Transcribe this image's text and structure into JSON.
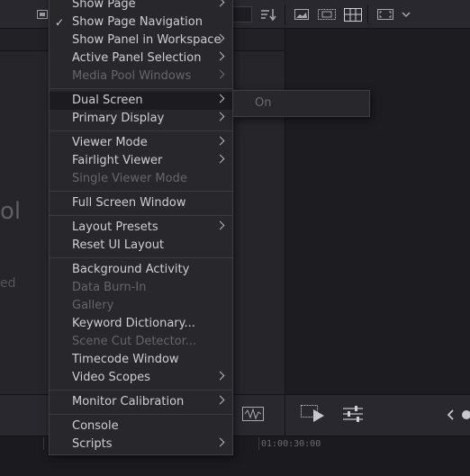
{
  "menu": {
    "items": [
      {
        "label": "Show Page",
        "submenu": true
      },
      {
        "label": "Show Page Navigation",
        "checked": true
      },
      {
        "label": "Show Panel in Workspace",
        "submenu": true
      },
      {
        "label": "Active Panel Selection",
        "submenu": true
      },
      {
        "label": "Media Pool Windows",
        "submenu": true,
        "disabled": true
      },
      {
        "label": "Dual Screen",
        "submenu": true,
        "highlighted": true
      },
      {
        "label": "Primary Display",
        "submenu": true
      },
      {
        "label": "Viewer Mode",
        "submenu": true
      },
      {
        "label": "Fairlight Viewer",
        "submenu": true
      },
      {
        "label": "Single Viewer Mode",
        "disabled": true
      },
      {
        "label": "Full Screen Window"
      },
      {
        "label": "Layout Presets",
        "submenu": true
      },
      {
        "label": "Reset UI Layout"
      },
      {
        "label": "Background Activity"
      },
      {
        "label": "Data Burn-In",
        "disabled": true
      },
      {
        "label": "Gallery",
        "disabled": true
      },
      {
        "label": "Keyword Dictionary..."
      },
      {
        "label": "Scene Cut Detector...",
        "disabled": true
      },
      {
        "label": "Timecode Window"
      },
      {
        "label": "Video Scopes",
        "submenu": true
      },
      {
        "label": "Monitor Calibration",
        "submenu": true
      },
      {
        "label": "Console"
      },
      {
        "label": "Scripts",
        "submenu": true
      }
    ]
  },
  "submenu": {
    "dual_screen": {
      "item": "On",
      "disabled": true
    }
  },
  "background": {
    "big_text": "ol",
    "small_text": "ed",
    "timecode": "01:00:30:00"
  },
  "colors": {
    "menu_bg": "#27272c",
    "highlight_bg": "#1c1c20",
    "text": "#cfcfd2",
    "disabled_text": "#65656b"
  }
}
